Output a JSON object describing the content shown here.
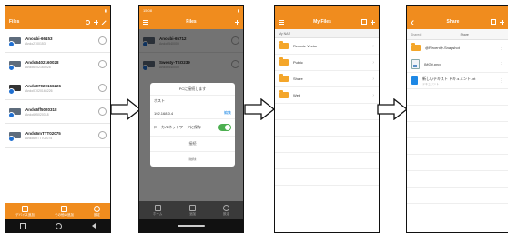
{
  "colors": {
    "orange": "#f08c1e",
    "orange_dark": "#e5811a",
    "phone_dark": "#3a3a3a"
  },
  "screen1": {
    "status_time": "",
    "title": "Files",
    "devices": [
      {
        "name": "Anoubi-66153",
        "sub": "Ando2100153"
      },
      {
        "name": "Ando6402160028",
        "sub": "Ando6402160028"
      },
      {
        "name": "Ando07020166226",
        "sub": "Ando07020166226"
      },
      {
        "name": "Ando6ff5020318",
        "sub": "Ando6ff5020318"
      },
      {
        "name": "Ando6mTTT02075",
        "sub": "Ando6mTTT02075"
      }
    ],
    "bottom_nav": [
      {
        "icon": "device-icon",
        "label": "デバイス追加"
      },
      {
        "icon": "add-icon",
        "label": "その他の追加"
      },
      {
        "icon": "settings-icon",
        "label": "設定"
      }
    ]
  },
  "screen2": {
    "status_time": "15:08",
    "title": "Files",
    "devices": [
      {
        "name": "Anoubi-65712",
        "sub": "Ando6540000"
      },
      {
        "name": "Sweaty-TSO239",
        "sub": "Ando6540000"
      }
    ],
    "dialog": {
      "title": "PCに接続します",
      "field_label": "ホスト",
      "field_value": "192.168.0.4",
      "field_action": "編集",
      "toggle_label": "ローカルネットワークに保存",
      "buttons": [
        "接続",
        "削除"
      ]
    },
    "bottom_labels": [
      "ホーム",
      "追加",
      "設定"
    ]
  },
  "screen3": {
    "title": "My Files",
    "section": "My NAS",
    "folders": [
      {
        "name": "Remote Vector"
      },
      {
        "name": "Public"
      },
      {
        "name": "Share"
      },
      {
        "name": "Web"
      }
    ]
  },
  "screen4": {
    "title": "Share",
    "path_back": "Shared",
    "path_current": "Share",
    "items": [
      {
        "type": "folder",
        "name": "@Recently-Snapshot",
        "sub": ""
      },
      {
        "type": "image",
        "name": "IMG0.png",
        "sub": ""
      },
      {
        "type": "doc",
        "name": "新しいテキスト ドキュメント.txt",
        "sub": "ドキュメント"
      }
    ]
  }
}
